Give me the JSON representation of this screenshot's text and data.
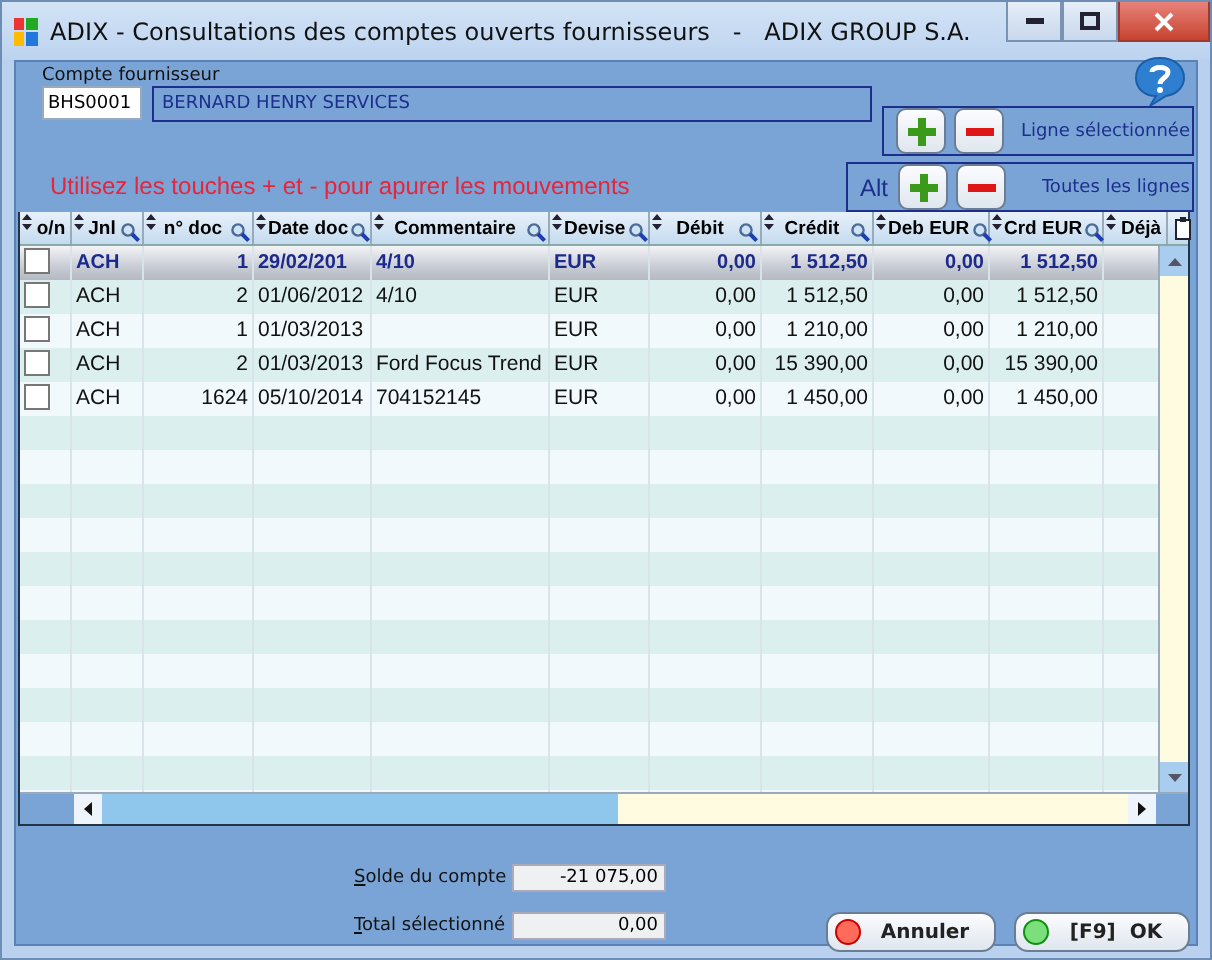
{
  "window": {
    "title": "ADIX - Consultations des comptes ouverts fournisseurs   -   ADIX GROUP S.A."
  },
  "account": {
    "label": "Compte fournisseur",
    "code": "BHS0001",
    "name": "BERNARD HENRY SERVICES"
  },
  "hint": "Utilisez les touches + et - pour apurer les mouvements",
  "line_actions": [
    {
      "label": "Ligne sélectionnée"
    },
    {
      "modifier": "Alt",
      "label": "Toutes les lignes"
    }
  ],
  "table": {
    "columns": [
      {
        "label": "o/n",
        "searchable": false
      },
      {
        "label": "Jnl",
        "searchable": true
      },
      {
        "label": "n° doc",
        "searchable": true
      },
      {
        "label": "Date doc",
        "searchable": true
      },
      {
        "label": "Commentaire",
        "searchable": true
      },
      {
        "label": "Devise",
        "searchable": true
      },
      {
        "label": "Débit",
        "searchable": true
      },
      {
        "label": "Crédit",
        "searchable": true
      },
      {
        "label": "Deb EUR",
        "searchable": true
      },
      {
        "label": "Crd EUR",
        "searchable": true
      },
      {
        "label": "Déjà",
        "searchable": false
      }
    ],
    "rows": [
      {
        "selected": true,
        "checked": false,
        "jnl": "ACH",
        "doc_no": "1",
        "date": "29/02/201",
        "comment": "4/10",
        "currency": "EUR",
        "debit": "0,00",
        "credit": "1 512,50",
        "deb_eur": "0,00",
        "crd_eur": "1 512,50"
      },
      {
        "selected": false,
        "checked": false,
        "jnl": "ACH",
        "doc_no": "2",
        "date": "01/06/2012",
        "comment": "4/10",
        "currency": "EUR",
        "debit": "0,00",
        "credit": "1 512,50",
        "deb_eur": "0,00",
        "crd_eur": "1 512,50"
      },
      {
        "selected": false,
        "checked": false,
        "jnl": "ACH",
        "doc_no": "1",
        "date": "01/03/2013",
        "currency": "EUR",
        "debit": "0,00",
        "credit": "1 210,00",
        "deb_eur": "0,00",
        "crd_eur": "1 210,00"
      },
      {
        "selected": false,
        "checked": false,
        "jnl": "ACH",
        "doc_no": "2",
        "date": "01/03/2013",
        "comment": "Ford Focus Trend",
        "currency": "EUR",
        "debit": "0,00",
        "credit": "15 390,00",
        "deb_eur": "0,00",
        "crd_eur": "15 390,00"
      },
      {
        "selected": false,
        "checked": false,
        "jnl": "ACH",
        "doc_no": "1624",
        "date": "05/10/2014",
        "comment": "704152145",
        "currency": "EUR",
        "debit": "0,00",
        "credit": "1 450,00",
        "deb_eur": "0,00",
        "crd_eur": "1 450,00"
      }
    ]
  },
  "totals": [
    {
      "label": "Solde du compte",
      "value": "-21 075,00"
    },
    {
      "label": "Total sélectionné",
      "value": "0,00"
    }
  ],
  "buttons": [
    {
      "kind": "cancel",
      "label": "Annuler"
    },
    {
      "kind": "ok",
      "label": "[F9]  OK"
    }
  ]
}
